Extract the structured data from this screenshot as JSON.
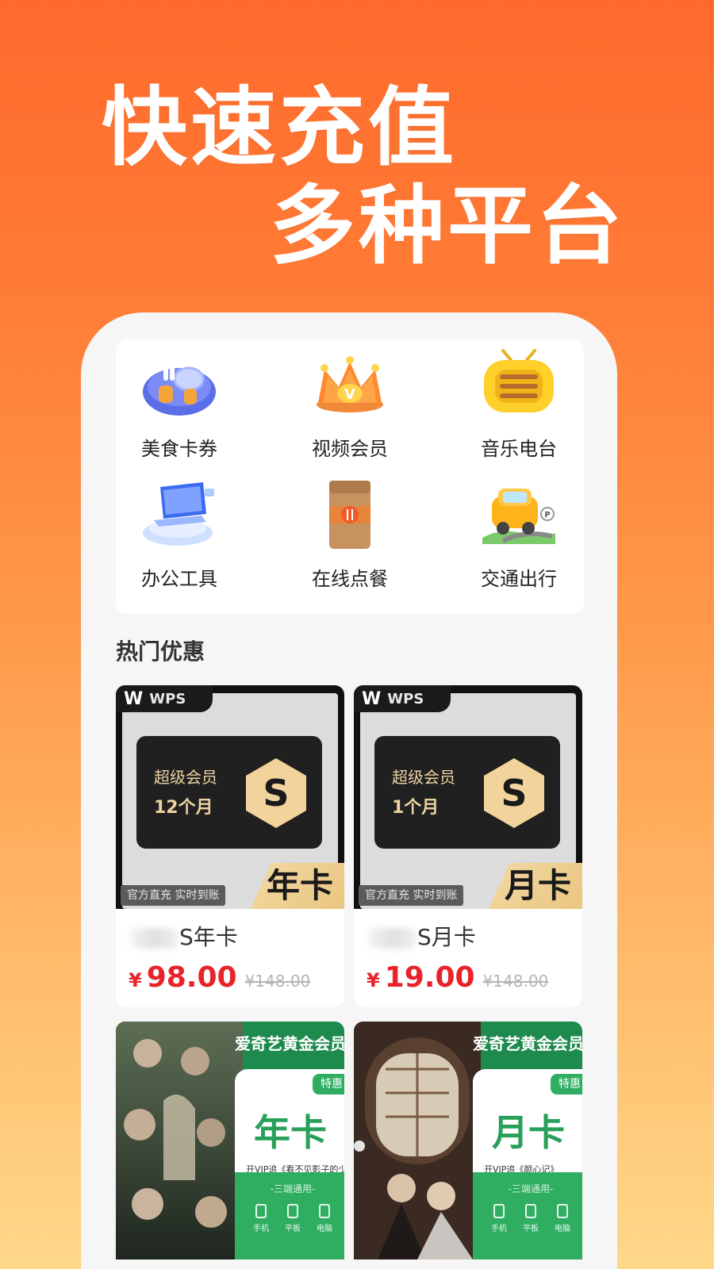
{
  "hero": {
    "line1": "快速充值",
    "line2": "多种平台"
  },
  "categories": [
    {
      "label": "美食卡券",
      "icon": "food-voucher-icon"
    },
    {
      "label": "视频会员",
      "icon": "video-crown-icon"
    },
    {
      "label": "音乐电台",
      "icon": "radio-icon"
    },
    {
      "label": "办公工具",
      "icon": "office-laptop-icon"
    },
    {
      "label": "在线点餐",
      "icon": "food-bag-icon"
    },
    {
      "label": "交通出行",
      "icon": "car-icon"
    }
  ],
  "section": {
    "title": "热门优惠"
  },
  "products": [
    {
      "brand": "WPS",
      "vip_title": "超级会员",
      "vip_duration": "12个月",
      "tag_left": "官方直充 实时到账",
      "tag_right": "年卡",
      "name": "S年卡",
      "price_symbol": "¥",
      "price": "98.00",
      "price_old": "¥148.00"
    },
    {
      "brand": "WPS",
      "vip_title": "超级会员",
      "vip_duration": "1个月",
      "tag_left": "官方直充 实时到账",
      "tag_right": "月卡",
      "name": "S月卡",
      "price_symbol": "¥",
      "price": "19.00",
      "price_old": "¥148.00"
    }
  ],
  "iqiyi": [
    {
      "header": "爱奇艺黄金会员",
      "badge": "特惠",
      "big": "年卡",
      "promo": "开VIP追《看不见影子的少年》",
      "foot_label": "-三端通用-",
      "devices": [
        "手机",
        "平板",
        "电脑"
      ]
    },
    {
      "header": "爱奇艺黄金会员",
      "badge": "特惠",
      "big": "月卡",
      "promo": "开VIP追《颜心记》",
      "foot_label": "-三端通用-",
      "devices": [
        "手机",
        "平板",
        "电脑"
      ]
    }
  ],
  "colors": {
    "accent": "#ff6a2c",
    "price": "#e8232a",
    "iqiyi_green": "#2fae62"
  }
}
